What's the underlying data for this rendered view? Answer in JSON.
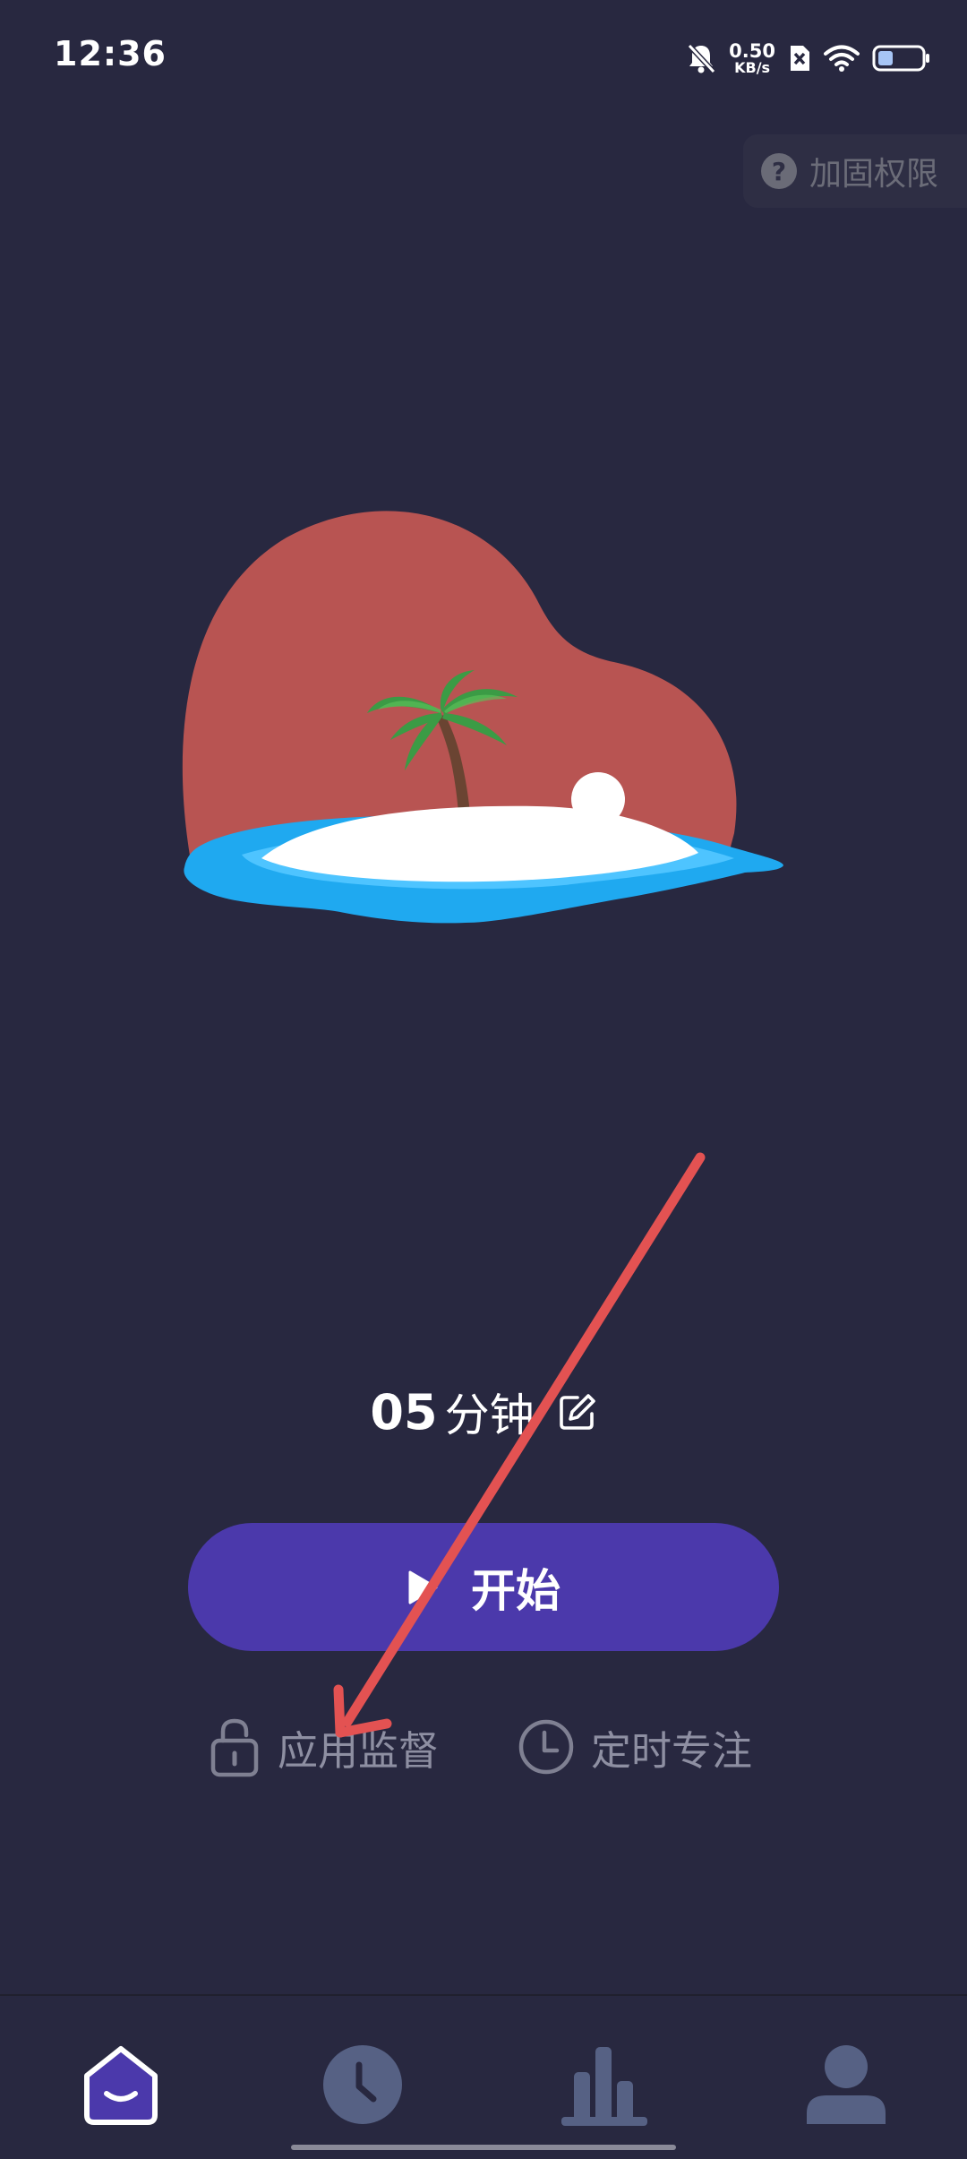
{
  "status_bar": {
    "time": "12:36",
    "net_speed_value": "0.50",
    "net_speed_unit": "KB/s",
    "battery_level": 0.35
  },
  "permission_chip": {
    "label": "加固权限",
    "icon": "help-icon"
  },
  "timer": {
    "minutes": "05",
    "unit": "分钟",
    "edit_icon": "edit-icon"
  },
  "start_button": {
    "label": "开始",
    "icon": "play-icon"
  },
  "options": {
    "supervise_label": "应用监督",
    "supervise_icon": "lock-icon",
    "scheduled_label": "定时专注",
    "scheduled_icon": "clock-icon"
  },
  "bottom_nav": {
    "items": [
      {
        "name": "home",
        "icon": "home-icon",
        "active": true
      },
      {
        "name": "history",
        "icon": "clock-icon",
        "active": false
      },
      {
        "name": "stats",
        "icon": "bar-chart-icon",
        "active": false
      },
      {
        "name": "profile",
        "icon": "user-icon",
        "active": false
      }
    ]
  },
  "colors": {
    "background": "#282840",
    "accent": "#4b39ab",
    "sun": "#b85452",
    "water": "#1fa9f0",
    "muted_text": "#8e8fa2",
    "annotation_arrow": "#e35252"
  }
}
